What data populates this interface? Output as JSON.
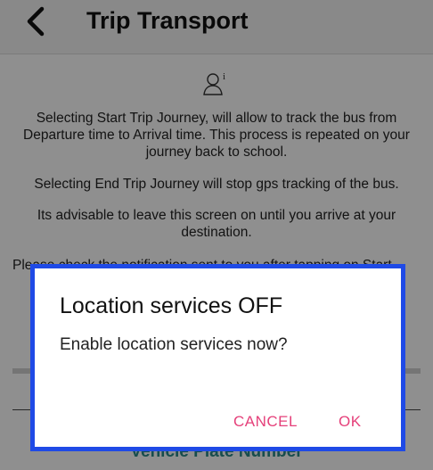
{
  "appbar": {
    "title": "Trip Transport",
    "back_icon": "chevron-left-icon"
  },
  "content": {
    "info_icon": "user-info-icon",
    "paragraph1": "Selecting Start Trip Journey, will allow to track the bus from Departure time to Arrival time. This process is repeated on your journey back to school.",
    "paragraph2": "Selecting End Trip Journey will stop gps tracking of the bus.",
    "paragraph3": "Its advisable to leave this screen on until you arrive at your destination.",
    "paragraph4_partial": "Please check the notification sent to you after tapping on Start",
    "vehicle_plate_label": "Vehicle Plate Number"
  },
  "dialog": {
    "title": "Location services OFF",
    "message": "Enable location services now?",
    "cancel_label": "CANCEL",
    "ok_label": "OK"
  },
  "colors": {
    "dialog_border": "#1f4ae6",
    "button_accent": "#e5407a",
    "plate_text": "#2a8a8a"
  }
}
